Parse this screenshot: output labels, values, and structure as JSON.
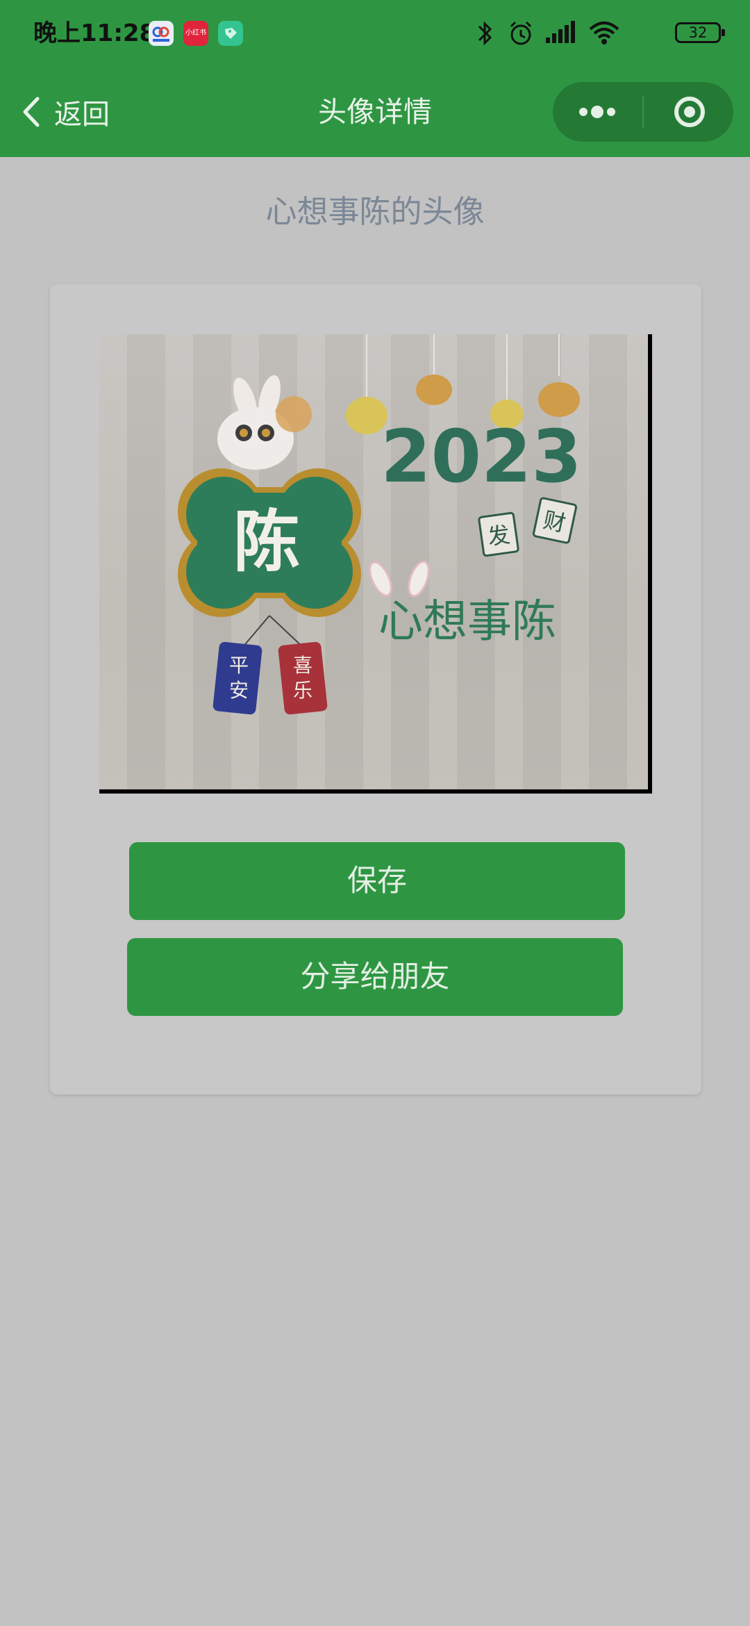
{
  "status_bar": {
    "time": "晚上11:28",
    "app_badges": [
      {
        "icon": "cloud-app-icon",
        "color": "#e9eef7"
      },
      {
        "icon": "xiaohongshu-app-icon",
        "label": "小红书",
        "color": "#e0243b"
      },
      {
        "icon": "tag-app-icon",
        "color": "#33c48f"
      }
    ],
    "battery": "32"
  },
  "nav": {
    "back_label": "返回",
    "title": "头像详情"
  },
  "main": {
    "heading": "心想事陈的头像",
    "avatar": {
      "center_char": "陈",
      "year_text": "2023",
      "tag_left": "发",
      "tag_right": "财",
      "slogan": "心想事陈",
      "tassel_left": [
        "平",
        "安"
      ],
      "tassel_right": [
        "喜",
        "乐"
      ]
    },
    "save_label": "保存",
    "share_label": "分享给朋友"
  },
  "colors": {
    "brand_green": "#2e9642",
    "page_bg": "#c2c2c2",
    "card_bg": "#c8c8c8",
    "heading_text": "#7b8796"
  }
}
